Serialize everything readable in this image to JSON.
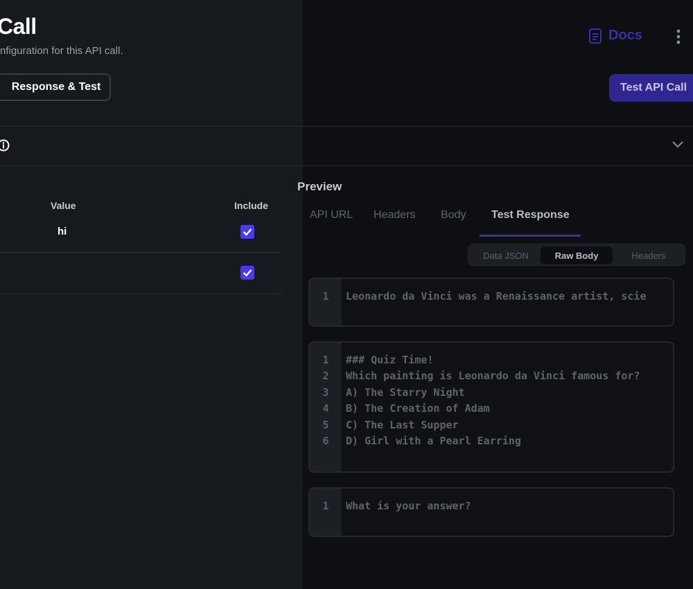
{
  "header": {
    "title": "Call",
    "subtitle": "nfiguration for this API call.",
    "response_test_label": "Response & Test",
    "docs_label": "Docs",
    "test_api_label": "Test API Call"
  },
  "variables_table": {
    "col_value": "Value",
    "col_include": "Include",
    "rows": [
      {
        "value": "hi",
        "include": true
      },
      {
        "value": "",
        "include": true
      }
    ]
  },
  "preview": {
    "title": "Preview",
    "tabs": [
      "API URL",
      "Headers",
      "Body",
      "Test Response"
    ],
    "active_tab": "Test Response",
    "segments": [
      "Data JSON",
      "Raw Body",
      "Headers"
    ],
    "active_segment": "Raw Body",
    "boxes": [
      {
        "lines": [
          {
            "n": "1",
            "text": "Leonardo da Vinci was a Renaissance artist, scie"
          }
        ]
      },
      {
        "lines": [
          {
            "n": "1",
            "text": "### Quiz Time!"
          },
          {
            "n": "2",
            "text": "Which painting is Leonardo da Vinci famous for?"
          },
          {
            "n": "3",
            "text": "A) The Starry Night"
          },
          {
            "n": "4",
            "text": "B) The Creation of Adam"
          },
          {
            "n": "5",
            "text": "C) The Last Supper"
          },
          {
            "n": "6",
            "text": "D) Girl with a Pearl Earring"
          }
        ]
      },
      {
        "lines": [
          {
            "n": "1",
            "text": "What is your answer?"
          }
        ]
      }
    ]
  },
  "colors": {
    "accent": "#4b39ef",
    "docs": "#3b2fb0",
    "test_button": "#2f2690"
  },
  "icons": [
    "docs-icon",
    "more-vertical-icon",
    "info-icon",
    "chevron-down-icon",
    "check-icon"
  ]
}
